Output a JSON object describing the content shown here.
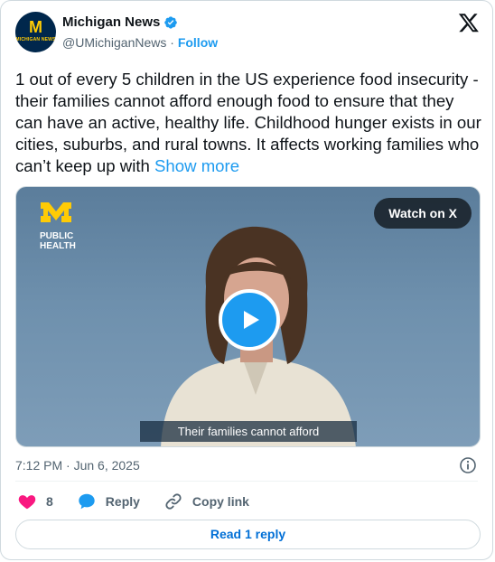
{
  "account": {
    "name": "Michigan News",
    "handle": "@UMichiganNews",
    "separator": "·",
    "follow_label": "Follow",
    "avatar_letter": "M",
    "avatar_text": "MICHIGAN NEWS"
  },
  "tweet": {
    "text": "1 out of every 5 children in the US experience food insecurity - their families cannot afford enough food to ensure that they can have an active, healthy life. Childhood hunger exists in our cities, suburbs, and rural towns. It affects working families who can’t keep up with",
    "show_more_label": "Show more"
  },
  "media": {
    "brand_line1": "PUBLIC",
    "brand_line2": "HEALTH",
    "watch_label": "Watch on X",
    "caption": "Their families cannot afford"
  },
  "meta": {
    "timestamp": "7:12 PM · Jun 6, 2025"
  },
  "actions": {
    "like_count": "8",
    "reply_label": "Reply",
    "copy_link_label": "Copy link"
  },
  "read_reply_label": "Read 1 reply",
  "icons": {
    "verified": "verified-badge-icon",
    "x": "x-logo-icon",
    "info": "info-icon",
    "heart": "heart-icon",
    "reply": "reply-bubble-icon",
    "link": "link-icon",
    "play": "play-icon"
  },
  "colors": {
    "accent": "#1d9bf0",
    "heart": "#f91880",
    "michigan_blue": "#00274c",
    "maize": "#ffcb05"
  }
}
